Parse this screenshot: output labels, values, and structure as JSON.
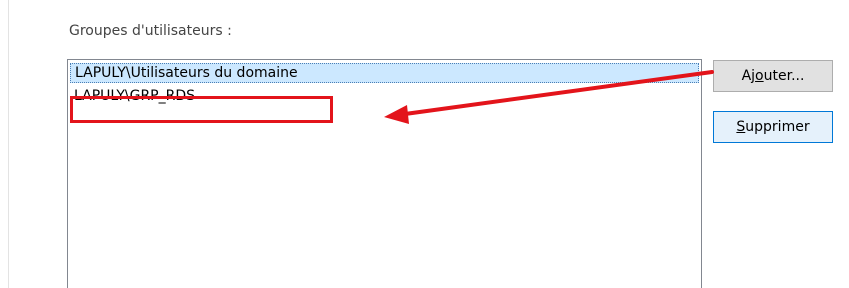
{
  "user_groups": {
    "label": "Groupes d'utilisateurs :",
    "items": [
      {
        "text": "LAPULY\\Utilisateurs du domaine",
        "selected": true
      },
      {
        "text": "LAPULY\\GRP_RDS",
        "selected": false
      }
    ]
  },
  "buttons": {
    "add": {
      "pre": "Aj",
      "accel": "o",
      "post": "uter..."
    },
    "remove": {
      "pre": "",
      "accel": "S",
      "post": "upprimer"
    }
  },
  "annotation": {
    "color": "#e3141b"
  }
}
